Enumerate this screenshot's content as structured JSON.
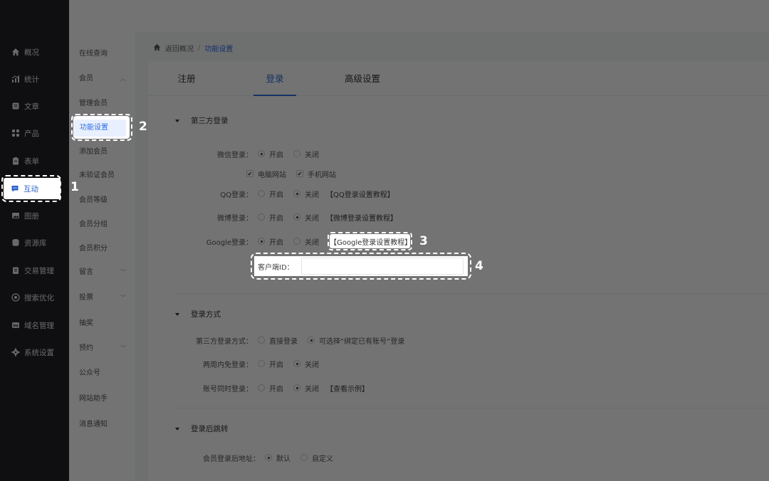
{
  "sidebar": {
    "items": [
      {
        "label": "概况",
        "icon": "home-icon"
      },
      {
        "label": "统计",
        "icon": "chart-icon"
      },
      {
        "label": "文章",
        "icon": "article-icon"
      },
      {
        "label": "产品",
        "icon": "grid-icon"
      },
      {
        "label": "表单",
        "icon": "clipboard-icon"
      },
      {
        "label": "互动",
        "icon": "chat-icon"
      },
      {
        "label": "图册",
        "icon": "gallery-icon"
      },
      {
        "label": "资源库",
        "icon": "database-icon"
      },
      {
        "label": "交易管理",
        "icon": "trade-icon"
      },
      {
        "label": "搜索优化",
        "icon": "seo-icon"
      },
      {
        "label": "域名管理",
        "icon": "domain-icon"
      },
      {
        "label": "系统设置",
        "icon": "gear-icon"
      }
    ],
    "active_index": 5
  },
  "submenu": {
    "online_query": "在线查询",
    "member_group": "会员",
    "manage_members": "管理会员",
    "feature_settings": "功能设置",
    "add_member": "添加会员",
    "unverified": "未验证会员",
    "member_level": "会员等级",
    "member_group_sub": "会员分组",
    "member_points": "会员积分",
    "message": "留言",
    "vote": "投票",
    "lottery": "抽奖",
    "booking": "预约",
    "official_account": "公众号",
    "site_assistant": "网站助手",
    "notifications": "消息通知"
  },
  "breadcrumb": {
    "back": "返回概况",
    "sep": "/",
    "current": "功能设置"
  },
  "tabs": [
    "注册",
    "登录",
    "高级设置"
  ],
  "sections": {
    "third_party": "第三方登录",
    "login_mode": "登录方式",
    "redirect": "登录后跳转"
  },
  "options": {
    "on": "开启",
    "off": "关闭"
  },
  "rows": {
    "wechat_label": "微信登录：",
    "pc_site": "电脑网站",
    "mobile_site": "手机网站",
    "qq_label": "QQ登录：",
    "qq_link": "【QQ登录设置教程】",
    "weibo_label": "微博登录：",
    "weibo_link": "【微博登录设置教程】",
    "google_label": "Google登录：",
    "google_link": "【Google登录设置教程】",
    "client_id_label": "客户端ID：",
    "client_id_value": "",
    "mode_label": "第三方登录方式：",
    "mode_direct": "直接登录",
    "mode_bind": "可选择“绑定已有账号”登录",
    "two_week_label": "两周内免登录：",
    "same_time_label": "账号同时登录：",
    "example_link": "【查看示例】",
    "redirect_label": "会员登录后地址：",
    "redirect_default": "默认",
    "redirect_custom": "自定义"
  },
  "markers": [
    "1",
    "2",
    "3",
    "4"
  ]
}
